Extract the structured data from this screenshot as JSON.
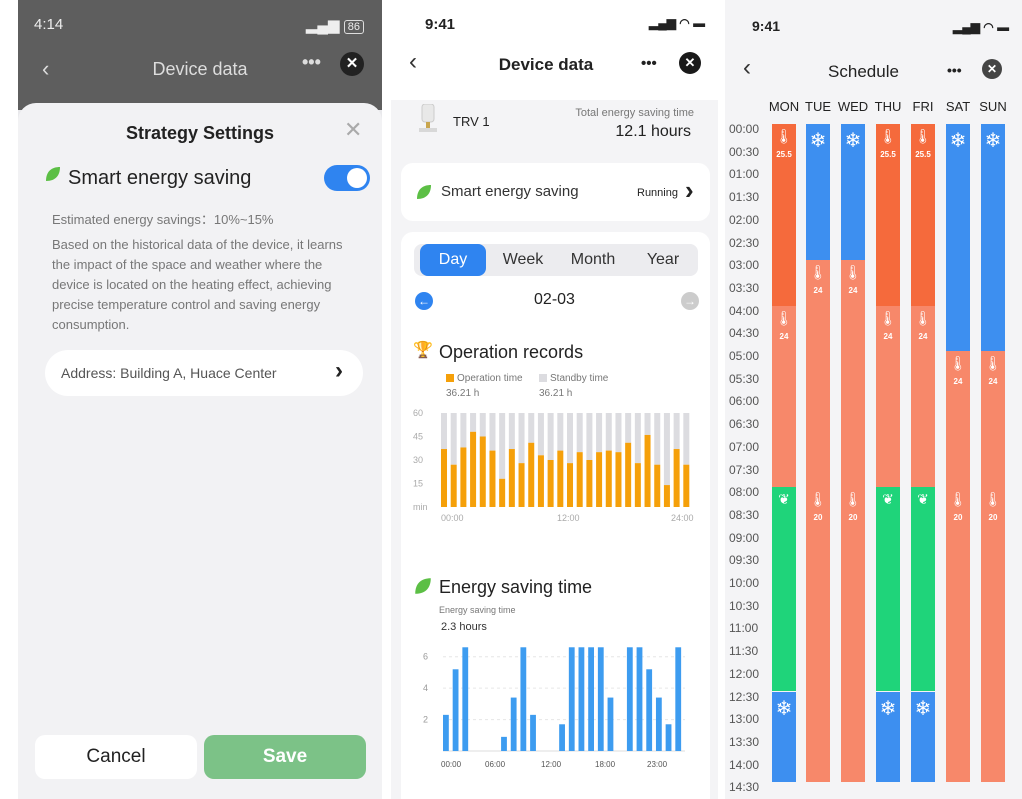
{
  "panel1": {
    "status": {
      "time": "4:14",
      "battery": "86"
    },
    "nav_title": "Device data",
    "sheet_title": "Strategy Settings",
    "smart_label": "Smart energy saving",
    "estimate": "Estimated energy savings：10%~15%",
    "description": "Based on the historical data of the device, it learns the impact of the space and weather where the device is located on the heating effect, achieving precise temperature control and saving energy consumption.",
    "address": "Address: Building A, Huace Center",
    "cancel_label": "Cancel",
    "save_label": "Save"
  },
  "panel2": {
    "status_time": "9:41",
    "nav_title": "Device data",
    "device_name": "TRV 1",
    "total_label": "Total energy saving time",
    "total_value": "12.1 hours",
    "smart_label": "Smart energy saving",
    "smart_status": "Running",
    "tabs": [
      "Day",
      "Week",
      "Month",
      "Year"
    ],
    "date": "02-03",
    "operation_title": "Operation records",
    "legend_operation": "Operation time",
    "legend_standby": "Standby time",
    "operation_value": "36.21 h",
    "standby_value": "36.21 h",
    "energy_title": "Energy saving time",
    "energy_sub": "Energy saving time",
    "energy_value": "2.3 hours",
    "colors": {
      "accent": "#2f84f0",
      "operation": "#f5a00a",
      "standby": "#dcdce0",
      "energy": "#3d9cf0",
      "leaf": "#5cbf45"
    }
  },
  "panel3": {
    "status_time": "9:41",
    "nav_title": "Schedule",
    "days": [
      "MON",
      "TUE",
      "WED",
      "THU",
      "FRI",
      "SAT",
      "SUN"
    ],
    "times": [
      "00:00",
      "00:30",
      "01:00",
      "01:30",
      "02:00",
      "02:30",
      "03:00",
      "03:30",
      "04:00",
      "04:30",
      "05:00",
      "05:30",
      "06:00",
      "06:30",
      "07:00",
      "07:30",
      "08:00",
      "08:30",
      "09:00",
      "09:30",
      "10:00",
      "10:30",
      "11:00",
      "11:30",
      "12:00",
      "12:30",
      "13:00",
      "13:30",
      "14:00",
      "14:30"
    ],
    "colors": {
      "comfort": "#f56a3c",
      "heat": "#f7886a",
      "cool": "#3d8ff0",
      "eco": "#1fd47a"
    }
  },
  "chart_data": [
    {
      "type": "bar",
      "title": "Operation records",
      "ylabel": "min",
      "ylim": [
        0,
        60
      ],
      "yticks": [
        "60",
        "45",
        "30",
        "15",
        "min"
      ],
      "xticks": [
        "00:00",
        "12:00",
        "24:00"
      ],
      "series": [
        {
          "name": "Operation time",
          "values": [
            37,
            27,
            38,
            48,
            45,
            36,
            18,
            37,
            28,
            41,
            33,
            30,
            36,
            28,
            35,
            30,
            35,
            36,
            35,
            41,
            28,
            46,
            27,
            14,
            37,
            27
          ]
        },
        {
          "name": "Standby time",
          "values": [
            23,
            33,
            22,
            12,
            15,
            24,
            42,
            23,
            32,
            19,
            27,
            30,
            24,
            32,
            25,
            30,
            25,
            24,
            25,
            19,
            32,
            14,
            33,
            46,
            23,
            33
          ]
        }
      ]
    },
    {
      "type": "bar",
      "title": "Energy saving time",
      "ylim": [
        0,
        7
      ],
      "yticks": [
        "6",
        "4",
        "2"
      ],
      "xticks": [
        "00:00",
        "06:00",
        "12:00",
        "18:00",
        "23:00"
      ],
      "series": [
        {
          "name": "Energy saving time",
          "values": [
            2.3,
            5.2,
            6.6,
            0,
            0,
            0,
            0.9,
            3.4,
            6.6,
            2.3,
            0,
            0,
            1.7,
            6.6,
            6.6,
            6.6,
            6.6,
            3.4,
            0,
            6.6,
            6.6,
            5.2,
            3.4,
            1.7,
            6.6
          ]
        }
      ]
    },
    {
      "type": "table",
      "title": "Schedule",
      "columns": [
        "MON",
        "TUE",
        "WED",
        "THU",
        "FRI",
        "SAT",
        "SUN"
      ],
      "rows": [
        {
          "day": "MON",
          "blocks": [
            {
              "from": "00:00",
              "to": "04:00",
              "mode": "comfort",
              "temp": "25.5"
            },
            {
              "from": "04:00",
              "to": "08:00",
              "mode": "heat",
              "temp": "24"
            },
            {
              "from": "08:00",
              "to": "12:30",
              "mode": "eco",
              "temp": ""
            },
            {
              "from": "12:30",
              "to": "14:30",
              "mode": "cool",
              "temp": ""
            }
          ]
        },
        {
          "day": "TUE",
          "blocks": [
            {
              "from": "00:00",
              "to": "03:00",
              "mode": "cool",
              "temp": ""
            },
            {
              "from": "03:00",
              "to": "08:00",
              "mode": "heat",
              "temp": "24"
            },
            {
              "from": "08:00",
              "to": "14:30",
              "mode": "heat",
              "temp": "20"
            }
          ]
        },
        {
          "day": "WED",
          "blocks": [
            {
              "from": "00:00",
              "to": "03:00",
              "mode": "cool",
              "temp": ""
            },
            {
              "from": "03:00",
              "to": "08:00",
              "mode": "heat",
              "temp": "24"
            },
            {
              "from": "08:00",
              "to": "14:30",
              "mode": "heat",
              "temp": "20"
            }
          ]
        },
        {
          "day": "THU",
          "blocks": [
            {
              "from": "00:00",
              "to": "04:00",
              "mode": "comfort",
              "temp": "25.5"
            },
            {
              "from": "04:00",
              "to": "08:00",
              "mode": "heat",
              "temp": "24"
            },
            {
              "from": "08:00",
              "to": "12:30",
              "mode": "eco",
              "temp": ""
            },
            {
              "from": "12:30",
              "to": "14:30",
              "mode": "cool",
              "temp": ""
            }
          ]
        },
        {
          "day": "FRI",
          "blocks": [
            {
              "from": "00:00",
              "to": "04:00",
              "mode": "comfort",
              "temp": "25.5"
            },
            {
              "from": "04:00",
              "to": "08:00",
              "mode": "heat",
              "temp": "24"
            },
            {
              "from": "08:00",
              "to": "12:30",
              "mode": "eco",
              "temp": ""
            },
            {
              "from": "12:30",
              "to": "14:30",
              "mode": "cool",
              "temp": ""
            }
          ]
        },
        {
          "day": "SAT",
          "blocks": [
            {
              "from": "00:00",
              "to": "05:00",
              "mode": "cool",
              "temp": ""
            },
            {
              "from": "05:00",
              "to": "08:00",
              "mode": "heat",
              "temp": "24"
            },
            {
              "from": "08:00",
              "to": "14:30",
              "mode": "heat",
              "temp": "20"
            }
          ]
        },
        {
          "day": "SUN",
          "blocks": [
            {
              "from": "00:00",
              "to": "05:00",
              "mode": "cool",
              "temp": ""
            },
            {
              "from": "05:00",
              "to": "08:00",
              "mode": "heat",
              "temp": "24"
            },
            {
              "from": "08:00",
              "to": "14:30",
              "mode": "heat",
              "temp": "20"
            }
          ]
        }
      ]
    }
  ]
}
